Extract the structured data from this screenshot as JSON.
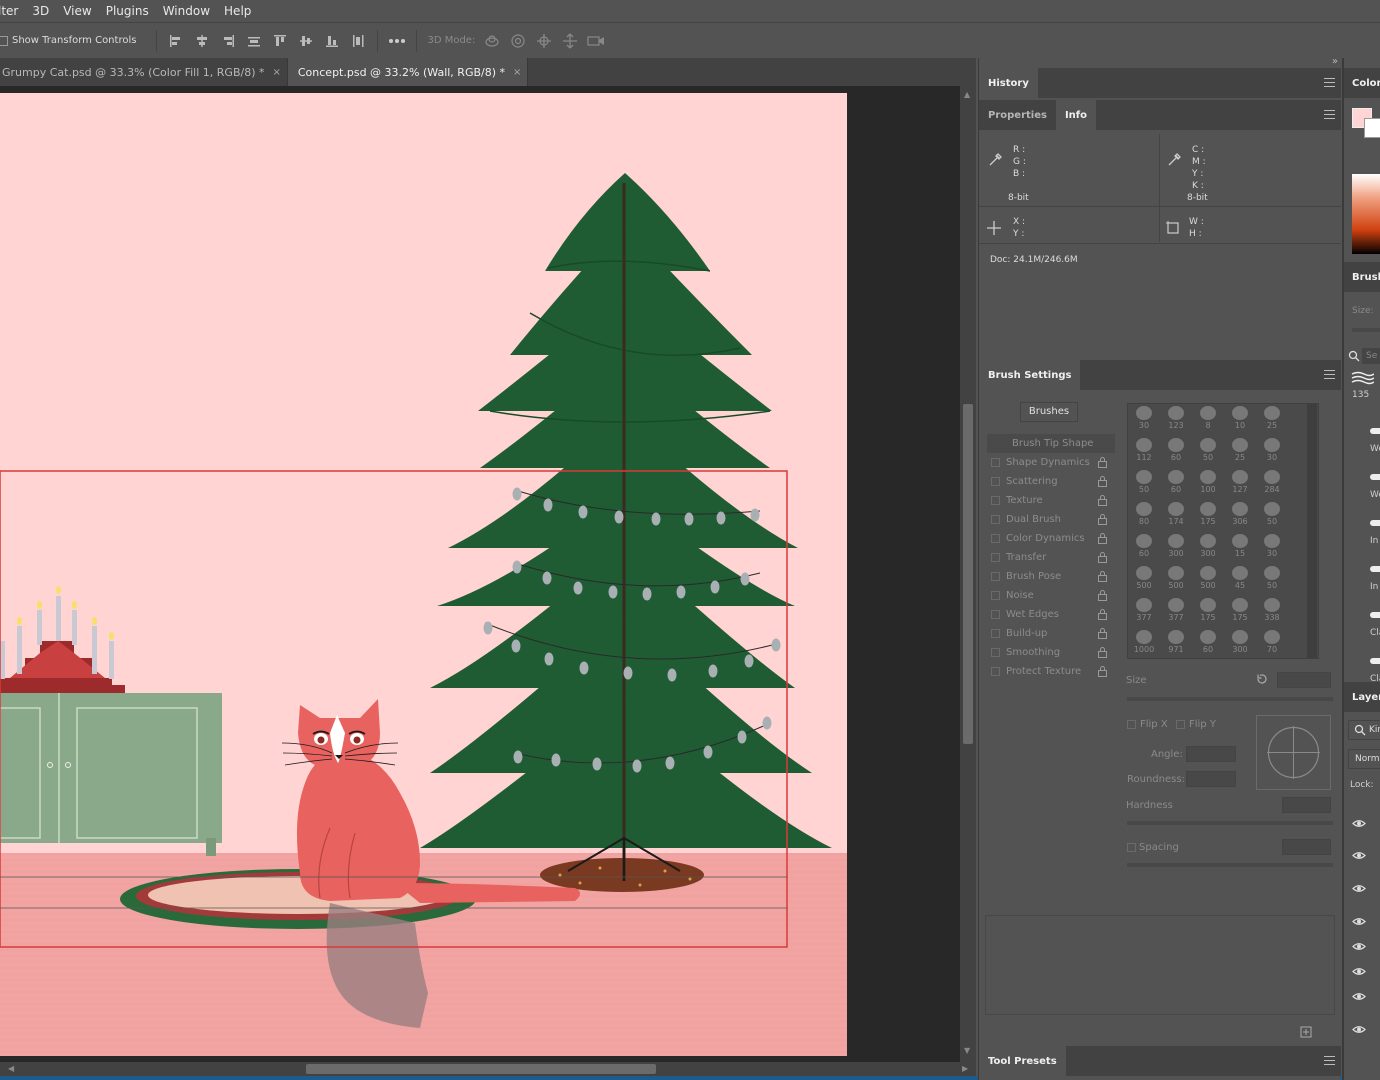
{
  "menu": {
    "items": [
      "lter",
      "3D",
      "View",
      "Plugins",
      "Window",
      "Help"
    ]
  },
  "options": {
    "show_transform_label": "Show Transform Controls",
    "mode_3d_label": "3D Mode:"
  },
  "tabs": [
    {
      "label": "Grumpy Cat.psd @ 33.3% (Color Fill 1, RGB/8) *",
      "close": "×"
    },
    {
      "label": "Concept.psd @ 33.2% (Wall, RGB/8) *",
      "close": "×"
    }
  ],
  "panels": {
    "history_tab": "History",
    "properties_tab": "Properties",
    "info_tab": "Info",
    "info": {
      "rgb_labels": "R :\nG :\nB :",
      "bit_left": "8-bit",
      "cmyk_labels": "C :\nM :\nY :\nK :",
      "bit_right": "8-bit",
      "xy_labels": "X :\nY :",
      "wh_labels": "W :\nH :",
      "doc": "Doc: 24.1M/246.6M"
    },
    "brush_settings_tab": "Brush Settings",
    "brushes_button": "Brushes",
    "brush_tip_shape": "Brush Tip Shape",
    "options_list": [
      "Shape Dynamics",
      "Scattering",
      "Texture",
      "Dual Brush",
      "Color Dynamics",
      "Transfer",
      "Brush Pose",
      "Noise",
      "Wet Edges",
      "Build-up",
      "Smoothing",
      "Protect Texture"
    ],
    "brush_sizes": [
      "30",
      "123",
      "8",
      "10",
      "25",
      "112",
      "60",
      "50",
      "25",
      "30",
      "50",
      "60",
      "100",
      "127",
      "284",
      "80",
      "174",
      "175",
      "306",
      "50",
      "60",
      "300",
      "300",
      "15",
      "30",
      "500",
      "500",
      "500",
      "45",
      "50",
      "377",
      "377",
      "175",
      "175",
      "338",
      "1000",
      "971",
      "60",
      "300",
      "70"
    ],
    "size_label": "Size",
    "flip_x": "Flip X",
    "flip_y": "Flip Y",
    "angle_label": "Angle:",
    "roundness_label": "Roundness:",
    "hardness_label": "Hardness",
    "spacing_label": "Spacing",
    "tool_presets_tab": "Tool Presets"
  },
  "right_dock": {
    "color_tab": "Color",
    "brushes_tab": "Brushe",
    "size_label": "Size:",
    "search_placeholder": "Se",
    "brush_count": "135",
    "brush_names": [
      "We",
      "We",
      "In",
      "In",
      "Cla",
      "Cla"
    ],
    "layers_tab": "Layers",
    "kind_label": "Kin",
    "blend_mode": "Norma",
    "lock_label": "Lock:"
  },
  "colors": {
    "wall": "#ffd4d2",
    "floor": "#f3a6a3",
    "tree": "#1f5c33",
    "cat": "#e8625f",
    "cabinet": "#8aa98a",
    "selection": "#d83a3a"
  }
}
